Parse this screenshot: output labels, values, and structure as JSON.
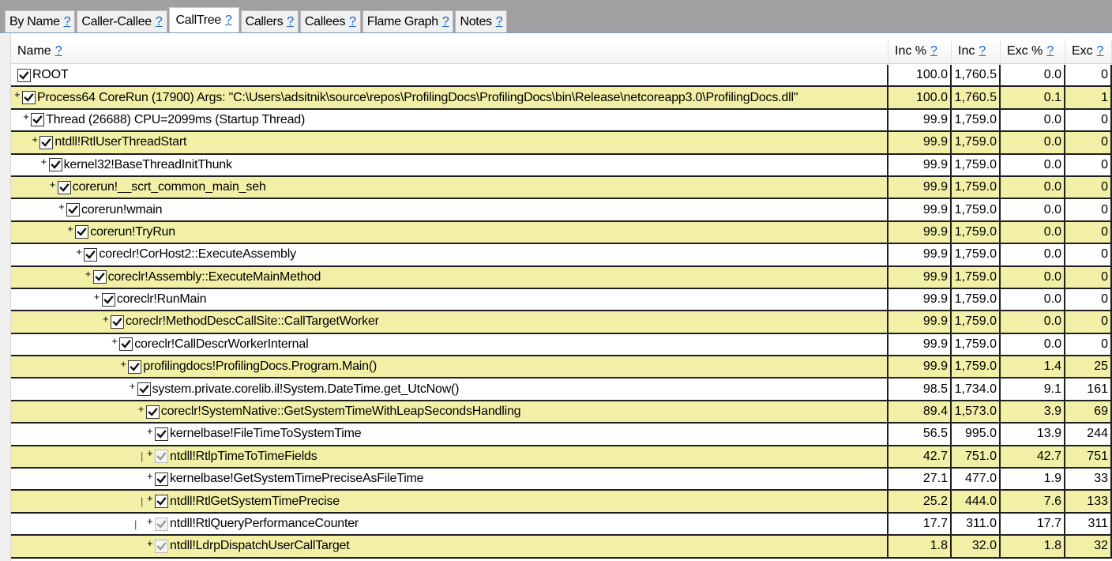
{
  "tabs": [
    {
      "label": "By Name",
      "help": "?",
      "active": false
    },
    {
      "label": "Caller-Callee",
      "help": "?",
      "active": false
    },
    {
      "label": "CallTree",
      "help": "?",
      "active": true
    },
    {
      "label": "Callers",
      "help": "?",
      "active": false
    },
    {
      "label": "Callees",
      "help": "?",
      "active": false
    },
    {
      "label": "Flame Graph",
      "help": "?",
      "active": false
    },
    {
      "label": "Notes",
      "help": "?",
      "active": false
    }
  ],
  "columns": {
    "name": {
      "label": "Name",
      "help": "?"
    },
    "inc_pct": {
      "label": "Inc %",
      "help": "?"
    },
    "inc": {
      "label": "Inc",
      "help": "?"
    },
    "exc_pct": {
      "label": "Exc %",
      "help": "?"
    },
    "exc": {
      "label": "Exc",
      "help": "?"
    }
  },
  "colors": {
    "row_alt": "#f2f0a6",
    "link": "#1a63c8",
    "topbar": "#a19fa1"
  },
  "rows": [
    {
      "depth": 0,
      "expander": "",
      "guides": "",
      "checked": true,
      "dim": false,
      "name": "ROOT",
      "inc_pct": "100.0",
      "inc": "1,760.5",
      "exc_pct": "0.0",
      "exc": "0"
    },
    {
      "depth": 0,
      "expander": "+",
      "guides": "",
      "checked": true,
      "dim": false,
      "name": "Process64 CoreRun (17900) Args:  \"C:\\Users\\adsitnik\\source\\repos\\ProfilingDocs\\ProfilingDocs\\bin\\Release\\netcoreapp3.0\\ProfilingDocs.dll\"",
      "inc_pct": "100.0",
      "inc": "1,760.5",
      "exc_pct": "0.1",
      "exc": "1"
    },
    {
      "depth": 1,
      "expander": "+",
      "guides": "",
      "checked": true,
      "dim": false,
      "name": "Thread (26688) CPU=2099ms (Startup Thread)",
      "inc_pct": "99.9",
      "inc": "1,759.0",
      "exc_pct": "0.0",
      "exc": "0"
    },
    {
      "depth": 2,
      "expander": "+",
      "guides": "",
      "checked": true,
      "dim": false,
      "name": "ntdll!RtlUserThreadStart",
      "inc_pct": "99.9",
      "inc": "1,759.0",
      "exc_pct": "0.0",
      "exc": "0"
    },
    {
      "depth": 3,
      "expander": "+",
      "guides": "",
      "checked": true,
      "dim": false,
      "name": "kernel32!BaseThreadInitThunk",
      "inc_pct": "99.9",
      "inc": "1,759.0",
      "exc_pct": "0.0",
      "exc": "0"
    },
    {
      "depth": 4,
      "expander": "+",
      "guides": "",
      "checked": true,
      "dim": false,
      "name": "corerun!__scrt_common_main_seh",
      "inc_pct": "99.9",
      "inc": "1,759.0",
      "exc_pct": "0.0",
      "exc": "0"
    },
    {
      "depth": 5,
      "expander": "+",
      "guides": "",
      "checked": true,
      "dim": false,
      "name": "corerun!wmain",
      "inc_pct": "99.9",
      "inc": "1,759.0",
      "exc_pct": "0.0",
      "exc": "0"
    },
    {
      "depth": 6,
      "expander": "+",
      "guides": "",
      "checked": true,
      "dim": false,
      "name": "corerun!TryRun",
      "inc_pct": "99.9",
      "inc": "1,759.0",
      "exc_pct": "0.0",
      "exc": "0"
    },
    {
      "depth": 7,
      "expander": "+",
      "guides": "",
      "checked": true,
      "dim": false,
      "name": "coreclr!CorHost2::ExecuteAssembly",
      "inc_pct": "99.9",
      "inc": "1,759.0",
      "exc_pct": "0.0",
      "exc": "0"
    },
    {
      "depth": 8,
      "expander": "+",
      "guides": "",
      "checked": true,
      "dim": false,
      "name": "coreclr!Assembly::ExecuteMainMethod",
      "inc_pct": "99.9",
      "inc": "1,759.0",
      "exc_pct": "0.0",
      "exc": "0"
    },
    {
      "depth": 9,
      "expander": "+",
      "guides": "",
      "checked": true,
      "dim": false,
      "name": "coreclr!RunMain",
      "inc_pct": "99.9",
      "inc": "1,759.0",
      "exc_pct": "0.0",
      "exc": "0"
    },
    {
      "depth": 10,
      "expander": "+",
      "guides": "",
      "checked": true,
      "dim": false,
      "name": "coreclr!MethodDescCallSite::CallTargetWorker",
      "inc_pct": "99.9",
      "inc": "1,759.0",
      "exc_pct": "0.0",
      "exc": "0"
    },
    {
      "depth": 11,
      "expander": "+",
      "guides": "",
      "checked": true,
      "dim": false,
      "name": "coreclr!CallDescrWorkerInternal",
      "inc_pct": "99.9",
      "inc": "1,759.0",
      "exc_pct": "0.0",
      "exc": "0"
    },
    {
      "depth": 12,
      "expander": "+",
      "guides": "",
      "checked": true,
      "dim": false,
      "name": "profilingdocs!ProfilingDocs.Program.Main()",
      "inc_pct": "99.9",
      "inc": "1,759.0",
      "exc_pct": "1.4",
      "exc": "25"
    },
    {
      "depth": 13,
      "expander": "+",
      "guides": "",
      "checked": true,
      "dim": false,
      "name": "system.private.corelib.il!System.DateTime.get_UtcNow()",
      "inc_pct": "98.5",
      "inc": "1,734.0",
      "exc_pct": "9.1",
      "exc": "161"
    },
    {
      "depth": 14,
      "expander": "+",
      "guides": "",
      "checked": true,
      "dim": false,
      "name": "coreclr!SystemNative::GetSystemTimeWithLeapSecondsHandling",
      "inc_pct": "89.4",
      "inc": "1,573.0",
      "exc_pct": "3.9",
      "exc": "69"
    },
    {
      "depth": 15,
      "expander": "+",
      "guides": "",
      "checked": true,
      "dim": false,
      "name": "kernelbase!FileTimeToSystemTime",
      "inc_pct": "56.5",
      "inc": "995.0",
      "exc_pct": "13.9",
      "exc": "244"
    },
    {
      "depth": 15,
      "expander": "+",
      "guides": "|",
      "checked": true,
      "dim": true,
      "name": "ntdll!RtlpTimeToTimeFields",
      "inc_pct": "42.7",
      "inc": "751.0",
      "exc_pct": "42.7",
      "exc": "751"
    },
    {
      "depth": 15,
      "expander": "+",
      "guides": "",
      "checked": true,
      "dim": false,
      "name": "kernelbase!GetSystemTimePreciseAsFileTime",
      "inc_pct": "27.1",
      "inc": "477.0",
      "exc_pct": "1.9",
      "exc": "33"
    },
    {
      "depth": 15,
      "expander": "+",
      "guides": "|",
      "checked": true,
      "dim": false,
      "name": "ntdll!RtlGetSystemTimePrecise",
      "inc_pct": "25.2",
      "inc": "444.0",
      "exc_pct": "7.6",
      "exc": "133"
    },
    {
      "depth": 15,
      "expander": "+",
      "guides": "| ",
      "checked": true,
      "dim": true,
      "name": "ntdll!RtlQueryPerformanceCounter",
      "inc_pct": "17.7",
      "inc": "311.0",
      "exc_pct": "17.7",
      "exc": "311"
    },
    {
      "depth": 15,
      "expander": "+",
      "guides": "",
      "checked": true,
      "dim": true,
      "name": "ntdll!LdrpDispatchUserCallTarget",
      "inc_pct": "1.8",
      "inc": "32.0",
      "exc_pct": "1.8",
      "exc": "32"
    }
  ]
}
